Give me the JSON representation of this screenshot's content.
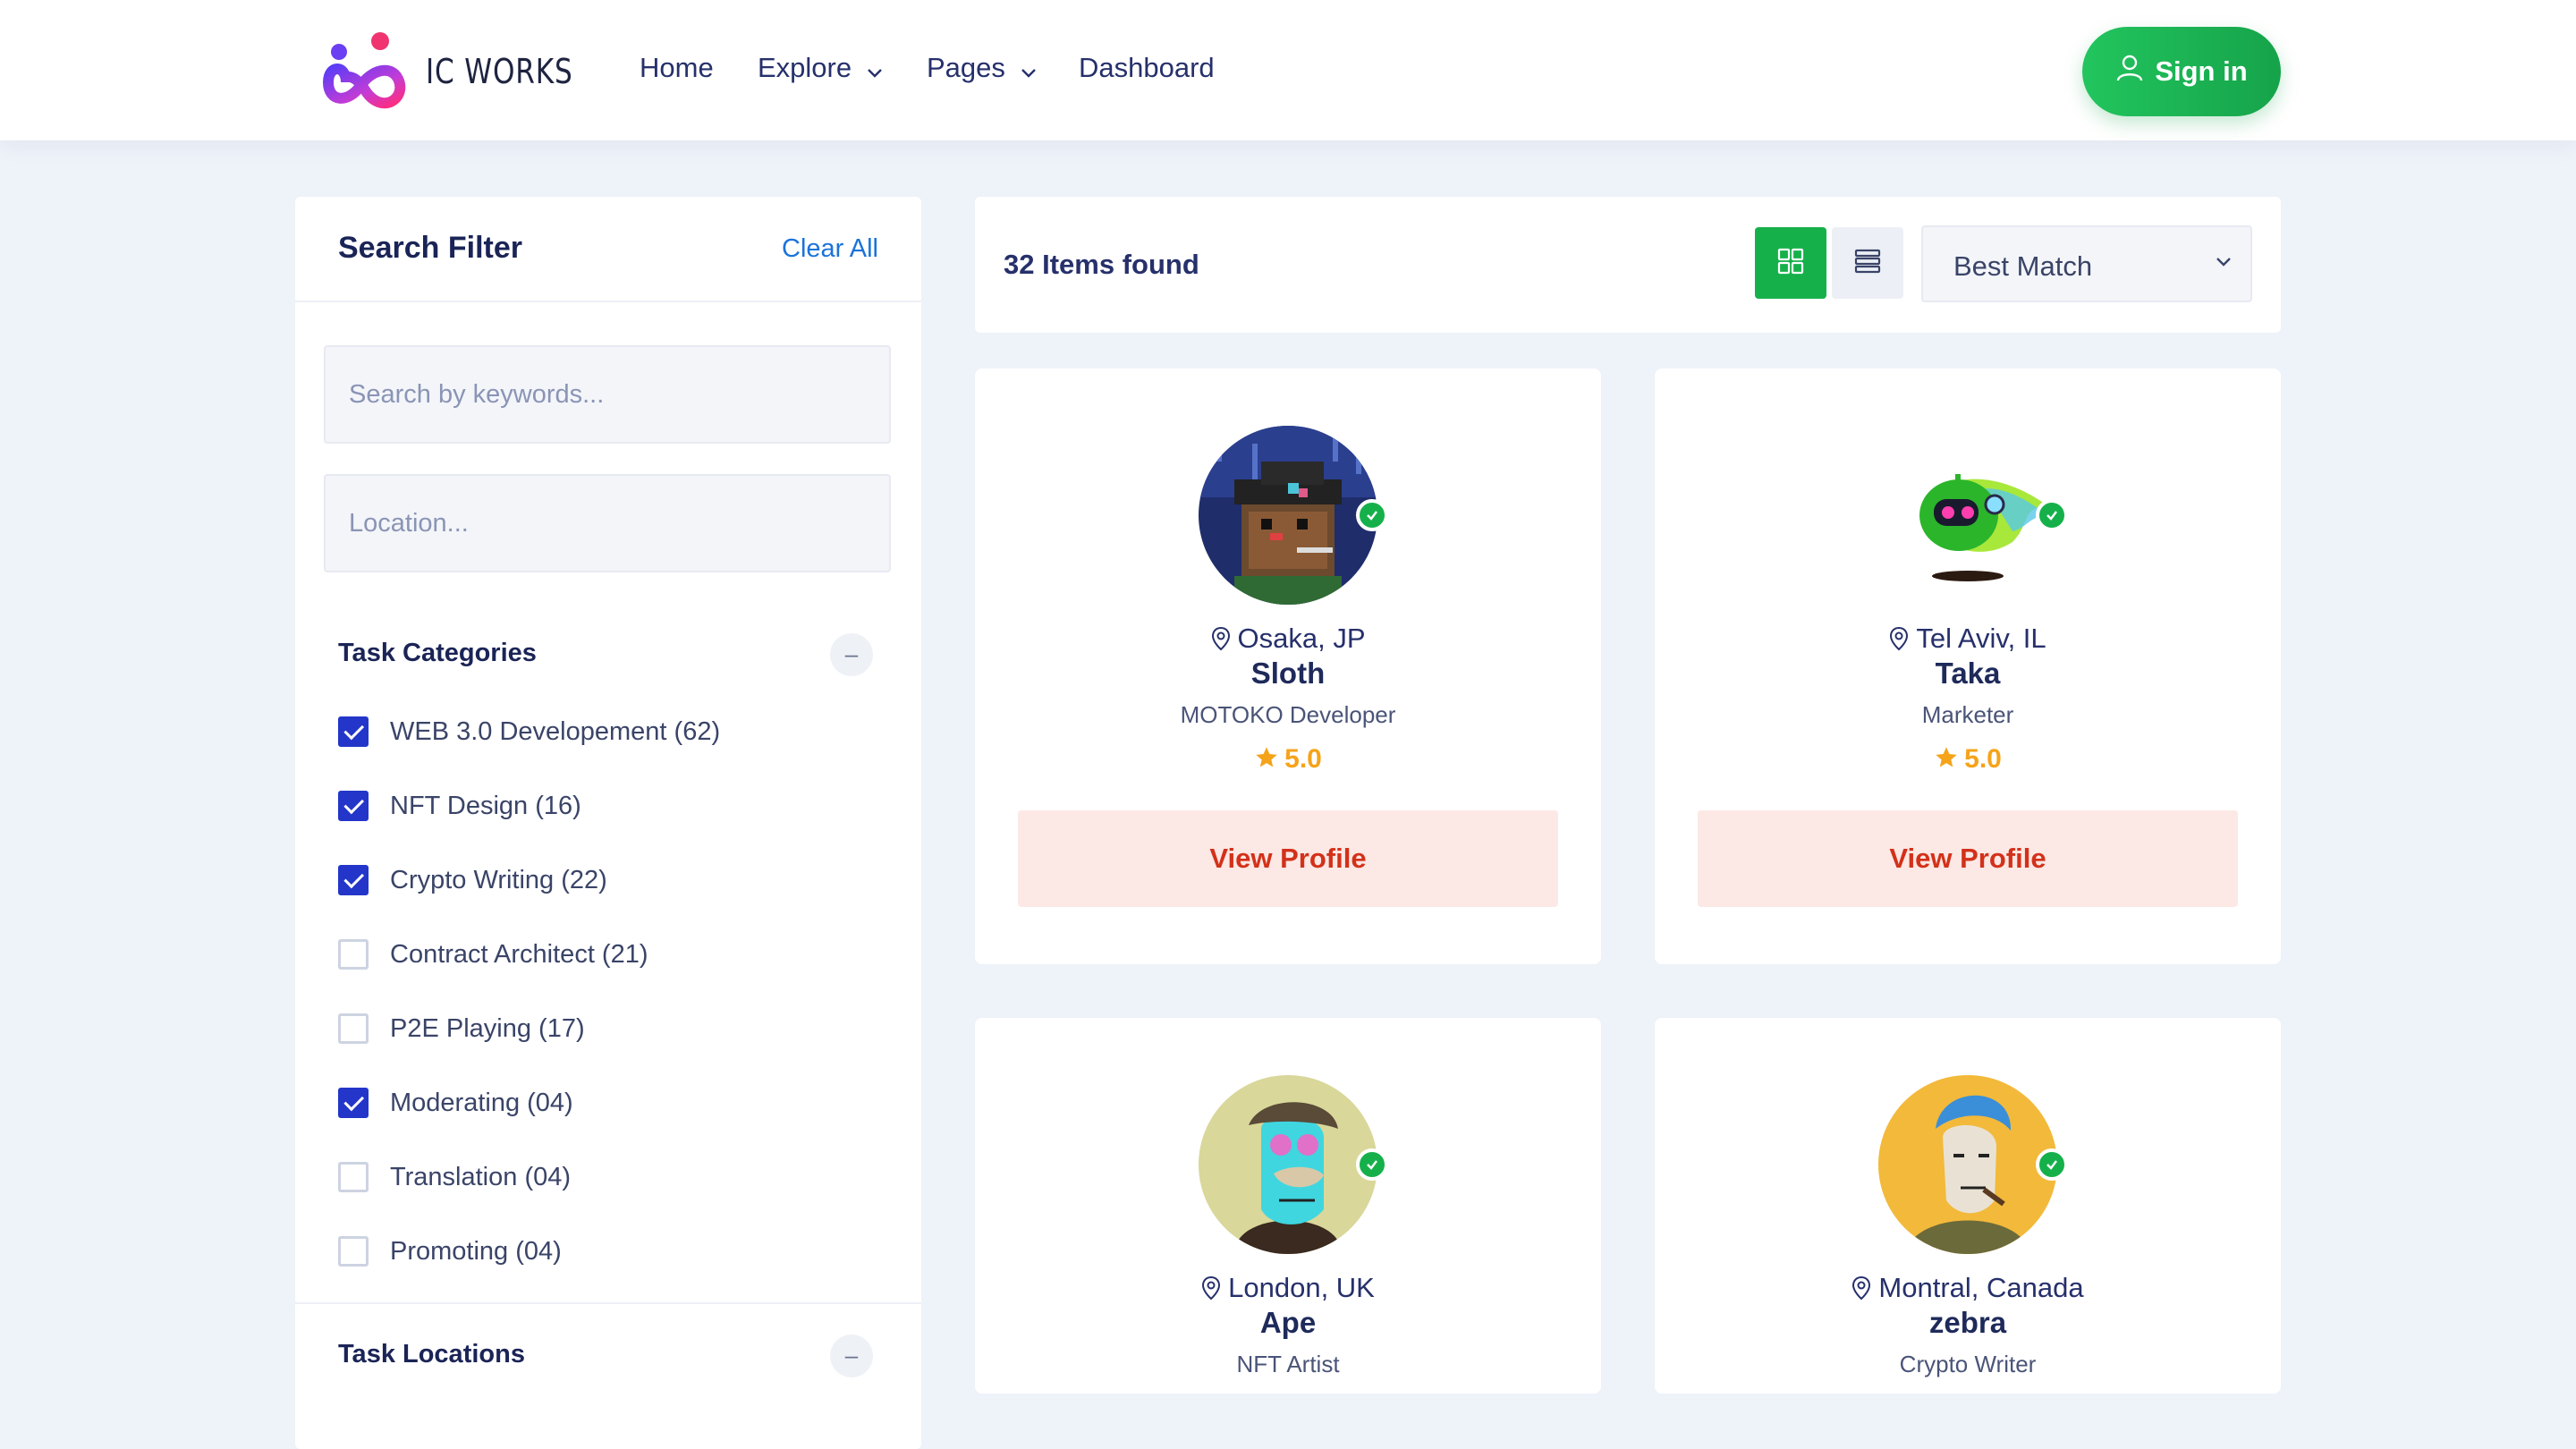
{
  "brand": {
    "name": "IC WORKS"
  },
  "nav": {
    "items": [
      {
        "label": "Home",
        "dropdown": false
      },
      {
        "label": "Explore",
        "dropdown": true
      },
      {
        "label": "Pages",
        "dropdown": true
      },
      {
        "label": "Dashboard",
        "dropdown": false
      }
    ],
    "signin_label": "Sign in"
  },
  "filter": {
    "title": "Search Filter",
    "clear_label": "Clear All",
    "keyword_placeholder": "Search by keywords...",
    "location_placeholder": "Location...",
    "categories_title": "Task Categories",
    "categories": [
      {
        "label": "WEB 3.0 Developement (62)",
        "checked": true
      },
      {
        "label": "NFT Design (16)",
        "checked": true
      },
      {
        "label": "Crypto Writing (22)",
        "checked": true
      },
      {
        "label": "Contract Architect (21)",
        "checked": false
      },
      {
        "label": "P2E Playing (17)",
        "checked": false
      },
      {
        "label": "Moderating (04)",
        "checked": true
      },
      {
        "label": "Translation (04)",
        "checked": false
      },
      {
        "label": "Promoting (04)",
        "checked": false
      }
    ],
    "locations_title": "Task Locations"
  },
  "results": {
    "count_text": "32 Items found",
    "sort_value": "Best Match"
  },
  "profiles": [
    {
      "location": "Osaka, JP",
      "name": "Sloth",
      "role": "MOTOKO Developer",
      "rating": "5.0",
      "cta": "View Profile"
    },
    {
      "location": "Tel Aviv, IL",
      "name": "Taka",
      "role": "Marketer",
      "rating": "5.0",
      "cta": "View Profile"
    },
    {
      "location": "London, UK",
      "name": "Ape",
      "role": "NFT Artist",
      "rating": "",
      "cta": ""
    },
    {
      "location": "Montral, Canada",
      "name": "zebra",
      "role": "Crypto Writer",
      "rating": "",
      "cta": ""
    }
  ],
  "colors": {
    "accent_green": "#16b04b",
    "checkbox_blue": "#2336c9",
    "cta_red": "#d3311a",
    "cta_bg": "#fce8e4",
    "star": "#f5a31a"
  }
}
